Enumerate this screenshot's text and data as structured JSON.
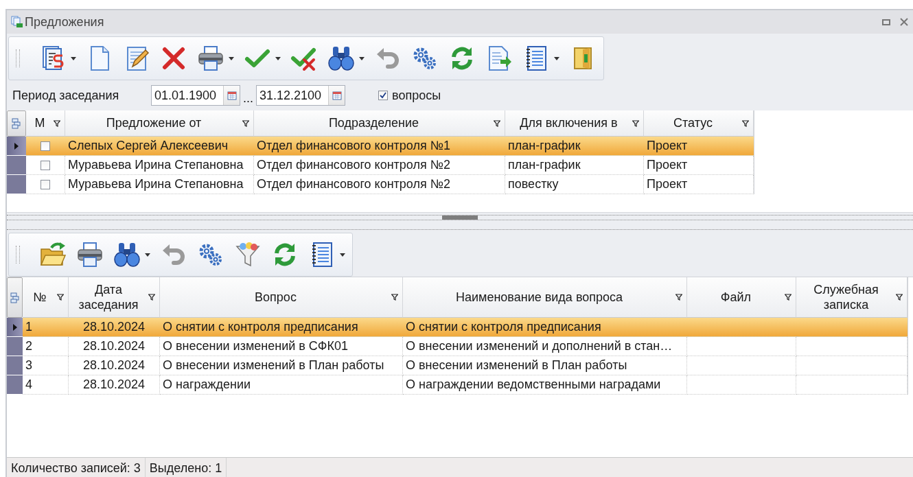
{
  "window": {
    "title": "Предложения"
  },
  "filter": {
    "label": "Период заседания",
    "date_from": "01.01.1900",
    "separator": "...",
    "date_to": "31.12.2100",
    "questions": {
      "label": "вопросы",
      "checked": true
    }
  },
  "proposals": {
    "mark_column": {
      "label": "М",
      "filter": true
    },
    "columns": [
      {
        "label": "Предложение от",
        "filter": true
      },
      {
        "label": "Подразделение",
        "filter": true
      },
      {
        "label": "Для включения в",
        "filter": true
      },
      {
        "label": "Статус",
        "filter": true
      }
    ],
    "rows": [
      {
        "selected": true,
        "marked": false,
        "cells": [
          "Слепых Сергей Алексеевич",
          "Отдел финансового контроля №1",
          "план-график",
          "Проект"
        ]
      },
      {
        "selected": false,
        "marked": false,
        "cells": [
          "Муравьева Ирина Степановна",
          "Отдел финансового контроля №2",
          "план-график",
          "Проект"
        ]
      },
      {
        "selected": false,
        "marked": false,
        "cells": [
          "Муравьева Ирина Степановна",
          "Отдел финансового контроля №2",
          "повестку",
          "Проект"
        ]
      }
    ]
  },
  "questions": {
    "columns": [
      {
        "label": "№",
        "filter": true
      },
      {
        "label": "Дата заседания",
        "filter": true
      },
      {
        "label": "Вопрос",
        "filter": true
      },
      {
        "label": "Наименование вида вопроса",
        "filter": true
      },
      {
        "label": "Файл",
        "filter": true
      },
      {
        "label": "Служебная записка",
        "filter": true
      }
    ],
    "rows": [
      {
        "selected": true,
        "cells": [
          "1",
          "28.10.2024",
          "О снятии с контроля предписания",
          "О снятии с контроля предписания",
          "",
          ""
        ]
      },
      {
        "selected": false,
        "cells": [
          "2",
          "28.10.2024",
          "О внесении изменений в СФК01",
          "О внесении изменений и дополнений в стан…",
          "",
          ""
        ]
      },
      {
        "selected": false,
        "cells": [
          "3",
          "28.10.2024",
          "О внесении изменений в План работы",
          "О внесении изменений в План работы",
          "",
          ""
        ]
      },
      {
        "selected": false,
        "cells": [
          "4",
          "28.10.2024",
          "О награждении",
          "О награждении ведомственными наградами",
          "",
          ""
        ]
      }
    ]
  },
  "status_bar": [
    "Количество записей: 3",
    "Выделено: 1"
  ]
}
